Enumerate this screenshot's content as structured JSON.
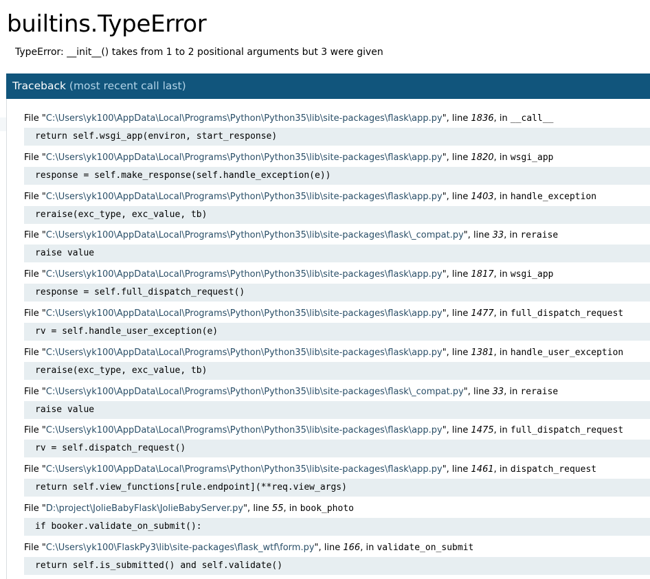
{
  "page": {
    "title": "builtins.TypeError",
    "error_message": "TypeError: __init__() takes from 1 to 2 positional arguments but 3 were given"
  },
  "traceback": {
    "header_label": "Traceback",
    "header_note": "(most recent call last)",
    "frames": [
      {
        "file_prefix": "File \"",
        "path": "C:\\Users\\yk100\\AppData\\Local\\Programs\\Python\\Python35\\lib\\site-packages\\flask\\app.py",
        "line_prefix": "\", line ",
        "lineno": "1836",
        "in_prefix": ", in ",
        "func": "__call__",
        "source": "return self.wsgi_app(environ, start_response)"
      },
      {
        "file_prefix": "File \"",
        "path": "C:\\Users\\yk100\\AppData\\Local\\Programs\\Python\\Python35\\lib\\site-packages\\flask\\app.py",
        "line_prefix": "\", line ",
        "lineno": "1820",
        "in_prefix": ", in ",
        "func": "wsgi_app",
        "source": "response = self.make_response(self.handle_exception(e))"
      },
      {
        "file_prefix": "File \"",
        "path": "C:\\Users\\yk100\\AppData\\Local\\Programs\\Python\\Python35\\lib\\site-packages\\flask\\app.py",
        "line_prefix": "\", line ",
        "lineno": "1403",
        "in_prefix": ", in ",
        "func": "handle_exception",
        "source": "reraise(exc_type, exc_value, tb)"
      },
      {
        "file_prefix": "File \"",
        "path": "C:\\Users\\yk100\\AppData\\Local\\Programs\\Python\\Python35\\lib\\site-packages\\flask\\_compat.py",
        "line_prefix": "\", line ",
        "lineno": "33",
        "in_prefix": ", in ",
        "func": "reraise",
        "source": "raise value"
      },
      {
        "file_prefix": "File \"",
        "path": "C:\\Users\\yk100\\AppData\\Local\\Programs\\Python\\Python35\\lib\\site-packages\\flask\\app.py",
        "line_prefix": "\", line ",
        "lineno": "1817",
        "in_prefix": ", in ",
        "func": "wsgi_app",
        "source": "response = self.full_dispatch_request()"
      },
      {
        "file_prefix": "File \"",
        "path": "C:\\Users\\yk100\\AppData\\Local\\Programs\\Python\\Python35\\lib\\site-packages\\flask\\app.py",
        "line_prefix": "\", line ",
        "lineno": "1477",
        "in_prefix": ", in ",
        "func": "full_dispatch_request",
        "source": "rv = self.handle_user_exception(e)"
      },
      {
        "file_prefix": "File \"",
        "path": "C:\\Users\\yk100\\AppData\\Local\\Programs\\Python\\Python35\\lib\\site-packages\\flask\\app.py",
        "line_prefix": "\", line ",
        "lineno": "1381",
        "in_prefix": ", in ",
        "func": "handle_user_exception",
        "source": "reraise(exc_type, exc_value, tb)"
      },
      {
        "file_prefix": "File \"",
        "path": "C:\\Users\\yk100\\AppData\\Local\\Programs\\Python\\Python35\\lib\\site-packages\\flask\\_compat.py",
        "line_prefix": "\", line ",
        "lineno": "33",
        "in_prefix": ", in ",
        "func": "reraise",
        "source": "raise value"
      },
      {
        "file_prefix": "File \"",
        "path": "C:\\Users\\yk100\\AppData\\Local\\Programs\\Python\\Python35\\lib\\site-packages\\flask\\app.py",
        "line_prefix": "\", line ",
        "lineno": "1475",
        "in_prefix": ", in ",
        "func": "full_dispatch_request",
        "source": "rv = self.dispatch_request()"
      },
      {
        "file_prefix": "File \"",
        "path": "C:\\Users\\yk100\\AppData\\Local\\Programs\\Python\\Python35\\lib\\site-packages\\flask\\app.py",
        "line_prefix": "\", line ",
        "lineno": "1461",
        "in_prefix": ", in ",
        "func": "dispatch_request",
        "source": "return self.view_functions[rule.endpoint](**req.view_args)"
      },
      {
        "file_prefix": "File \"",
        "path": "D:\\project\\JolieBabyFlask\\JolieBabyServer.py",
        "line_prefix": "\", line ",
        "lineno": "55",
        "in_prefix": ", in ",
        "func": "book_photo",
        "source": "if booker.validate_on_submit():"
      },
      {
        "file_prefix": "File \"",
        "path": "C:\\Users\\yk100\\FlaskPy3\\lib\\site-packages\\flask_wtf\\form.py",
        "line_prefix": "\", line ",
        "lineno": "166",
        "in_prefix": ", in ",
        "func": "validate_on_submit",
        "source": "return self.is_submitted() and self.validate()"
      }
    ]
  },
  "colors": {
    "header_bg": "#11557c",
    "header_note": "#b3d4e8",
    "source_bg": "#e7eef1",
    "filename": "#2a4f68"
  }
}
